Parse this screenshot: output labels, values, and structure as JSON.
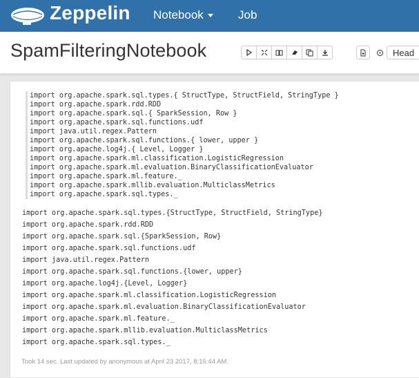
{
  "navbar": {
    "brand": "Zeppelin",
    "menu_notebook": "Notebook",
    "menu_job": "Job",
    "logo_icon": "zeppelin-airship-icon"
  },
  "notebook": {
    "title": "SpamFilteringNotebook",
    "toolbar_icons": [
      "play-icon",
      "expand-icon",
      "book-icon",
      "eraser-icon",
      "copy-icon",
      "download-icon"
    ],
    "doc_icon": "document-icon",
    "gear_icon": "gear-icon",
    "head_label": "Head"
  },
  "paragraph": {
    "code_lines": [
      "import org.apache.spark.sql.types.{ StructType, StructField, StringType }",
      "import org.apache.spark.rdd.RDD",
      "import org.apache.spark.sql.{ SparkSession, Row }",
      "import org.apache.spark.sql.functions.udf",
      "import java.util.regex.Pattern",
      "import org.apache.spark.sql.functions.{ lower, upper }",
      "import org.apache.log4j.{ Level, Logger }",
      "import org.apache.spark.ml.classification.LogisticRegression",
      "import org.apache.spark.ml.evaluation.BinaryClassificationEvaluator",
      "import org.apache.spark.ml.feature._",
      "import org.apache.spark.mllib.evaluation.MulticlassMetrics",
      "import org.apache.spark.sql.types._"
    ],
    "output_lines": [
      "import org.apache.spark.sql.types.{StructType, StructField, StringType}",
      "import org.apache.spark.rdd.RDD",
      "import org.apache.spark.sql.{SparkSession, Row}",
      "import org.apache.spark.sql.functions.udf",
      "import java.util.regex.Pattern",
      "import org.apache.spark.sql.functions.{lower, upper}",
      "import org.apache.log4j.{Level, Logger}",
      "import org.apache.spark.ml.classification.LogisticRegression",
      "import org.apache.spark.ml.evaluation.BinaryClassificationEvaluator",
      "import org.apache.spark.ml.feature._",
      "import org.apache.spark.mllib.evaluation.MulticlassMetrics",
      "import org.apache.spark.sql.types._"
    ],
    "status": "Took 14 sec. Last updated by anonymous at April 23 2017, 8:15:44 AM."
  }
}
